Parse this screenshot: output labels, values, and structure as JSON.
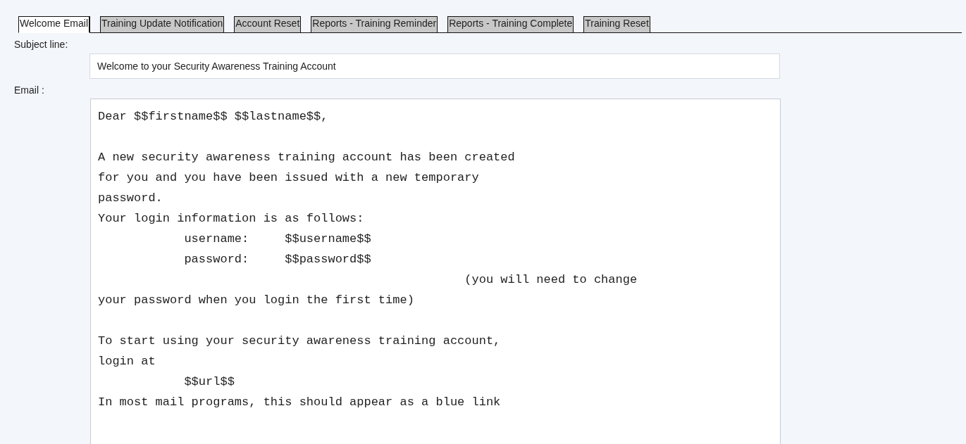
{
  "tabs": [
    {
      "label": "Welcome Email",
      "selected": true
    },
    {
      "label": "Training Update Notification",
      "selected": false
    },
    {
      "label": "Account Reset",
      "selected": false
    },
    {
      "label": "Reports - Training Reminder",
      "selected": false
    },
    {
      "label": "Reports - Training Complete",
      "selected": false
    },
    {
      "label": "Training Reset",
      "selected": false
    }
  ],
  "subject": {
    "label": "Subject line:",
    "value": "Welcome to your Security Awareness Training Account"
  },
  "email": {
    "label": "Email :",
    "value": "Dear $$firstname$$ $$lastname$$,\n\nA new security awareness training account has been created\nfor you and you have been issued with a new temporary\npassword.\nYour login information is as follows:\n            username:     $$username$$\n            password:     $$password$$\n                                                   (you will need to change\nyour password when you login the first time)\n\nTo start using your security awareness training account,\nlogin at\n            $$url$$\nIn most mail programs, this should appear as a blue link"
  }
}
